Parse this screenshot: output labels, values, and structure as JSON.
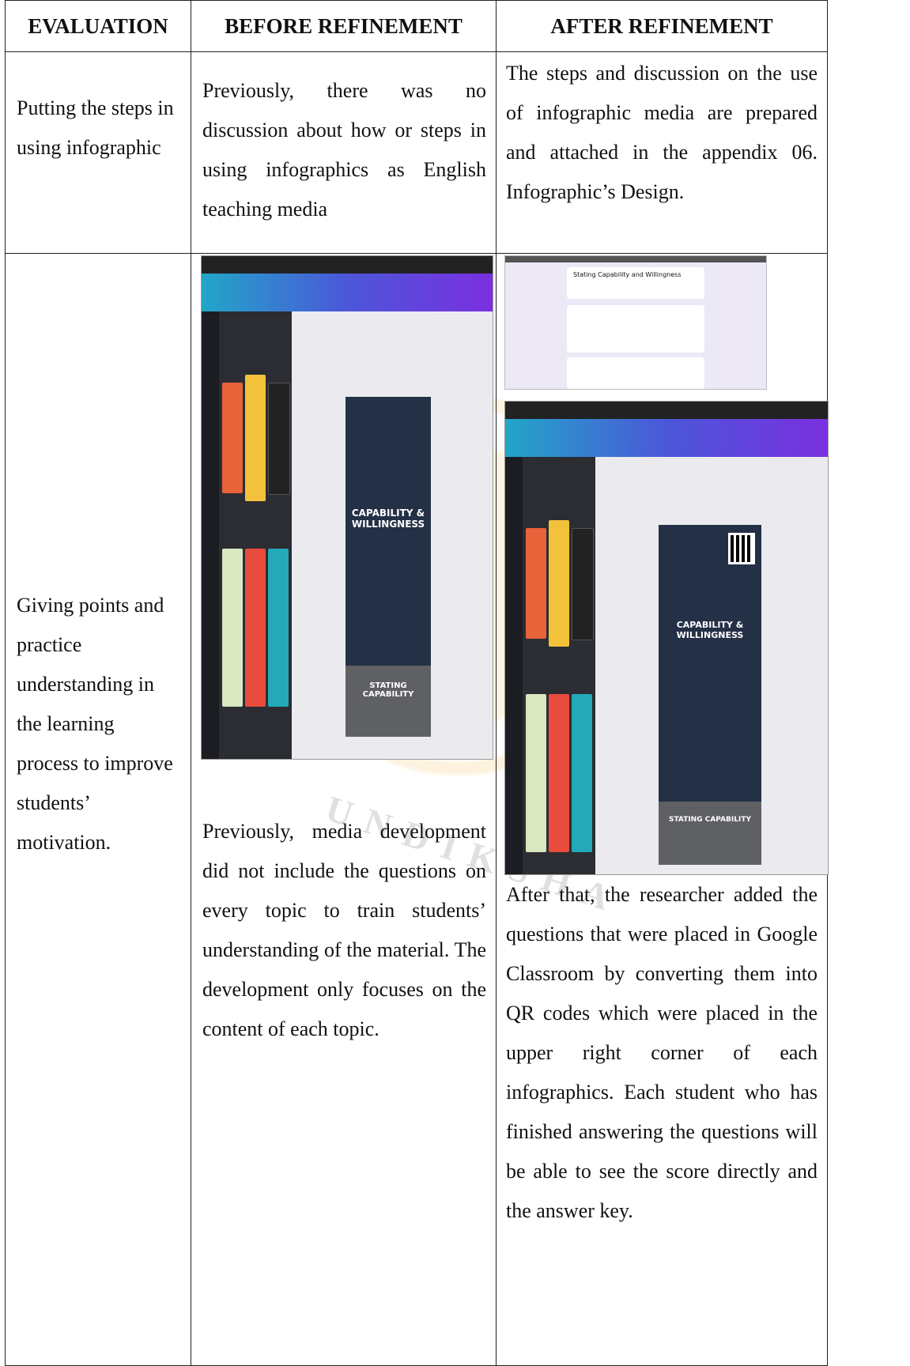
{
  "table": {
    "headers": [
      "EVALUATION",
      "BEFORE REFINEMENT",
      "AFTER REFINEMENT"
    ],
    "rows": [
      {
        "evaluation": "Putting the steps in using infographic",
        "before": "Previously, there was no discussion about how or steps in using infographics as English teaching media",
        "after": "The steps and discussion on the use of infographic media are prepared and attached in the appendix 06. Infographic’s Design."
      },
      {
        "evaluation": "Giving points and practice understanding in the learning process to improve students’ motivation.",
        "before": "Previously, media development did not include the questions on every topic to train students’ understanding of the material. The development only focuses on the content of each topic.",
        "after": "After that, the researcher added the questions that were placed in Google Classroom by converting them into QR codes which were placed in the upper right corner of each infographics. Each student who has finished answering the questions will be able to see the score directly and the answer key."
      }
    ]
  },
  "screens": {
    "before_poster_title": "CAPABILITY & WILLINGNESS",
    "before_poster_sub": "STATING CAPABILITY",
    "after_form_title": "Stating Capability and Willingness",
    "after_poster_title": "CAPABILITY & WILLINGNESS",
    "after_poster_sub": "STATING CAPABILITY"
  },
  "watermark": "UNDIKSHA"
}
